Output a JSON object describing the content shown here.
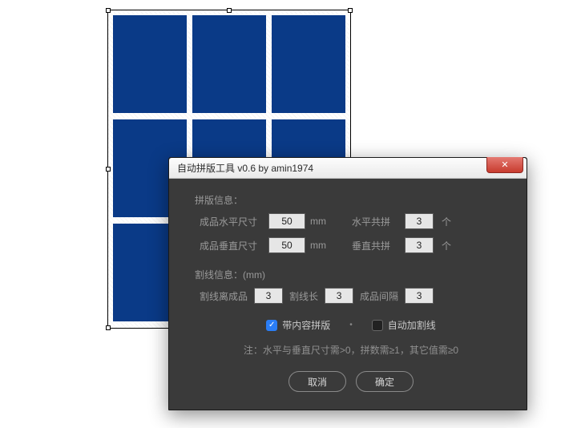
{
  "dialog": {
    "title": "自动拼版工具 v0.6   by amin1974",
    "section_imposition": "拼版信息：",
    "horiz_size_label": "成品水平尺寸",
    "vert_size_label": "成品垂直尺寸",
    "unit_mm": "mm",
    "horiz_count_label": "水平共拼",
    "vert_count_label": "垂直共拼",
    "unit_pcs": "个",
    "horiz_size_value": "50",
    "vert_size_value": "50",
    "horiz_count_value": "3",
    "vert_count_value": "3",
    "section_cutline": "割线信息：(mm)",
    "cut_dist_label": "割线离成品",
    "cut_dist_value": "3",
    "cut_len_label": "割线长",
    "cut_len_value": "3",
    "gap_label": "成品间隔",
    "gap_value": "3",
    "cbx_content_label": "带内容拼版",
    "cbx_cutline_label": "自动加割线",
    "note": "注：水平与垂直尺寸需>0，拼数需≥1，其它值需≥0",
    "btn_cancel": "取消",
    "btn_ok": "确定",
    "checkbox_content_checked": true,
    "checkbox_cutline_checked": false
  },
  "artboard": {
    "cols": 3,
    "rows": 3,
    "tile_color": "#0a3a87"
  }
}
